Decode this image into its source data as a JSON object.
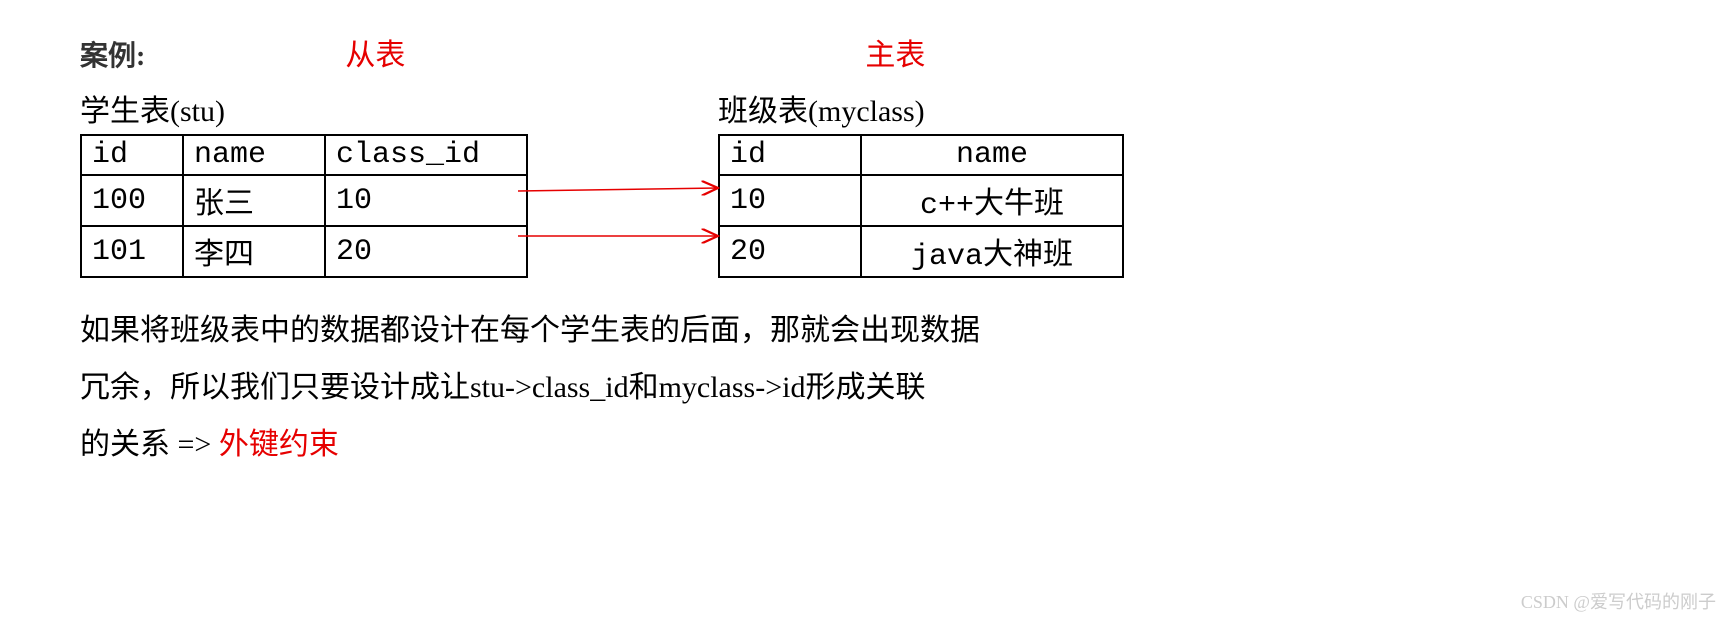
{
  "header": {
    "case_label": "案例:",
    "sub_label": "从表",
    "main_label": "主表"
  },
  "stu_table": {
    "title": "学生表(stu)",
    "headers": [
      "id",
      "name",
      "class_id"
    ],
    "rows": [
      [
        "100",
        "张三",
        "10"
      ],
      [
        "101",
        "李四",
        "20"
      ]
    ]
  },
  "class_table": {
    "title": "班级表(myclass)",
    "headers": [
      "id",
      "name"
    ],
    "rows": [
      [
        "10",
        "c++大牛班"
      ],
      [
        "20",
        "java大神班"
      ]
    ]
  },
  "paragraph": {
    "line1": "如果将班级表中的数据都设计在每个学生表的后面，那就会出现数据",
    "line2a": "冗余，所以我们只要设计成让stu->class_id和myclass->id形成关联",
    "line3a": "的关系 =>",
    "line3b": "外键约束"
  },
  "watermark": "CSDN @爱写代码的刚子"
}
